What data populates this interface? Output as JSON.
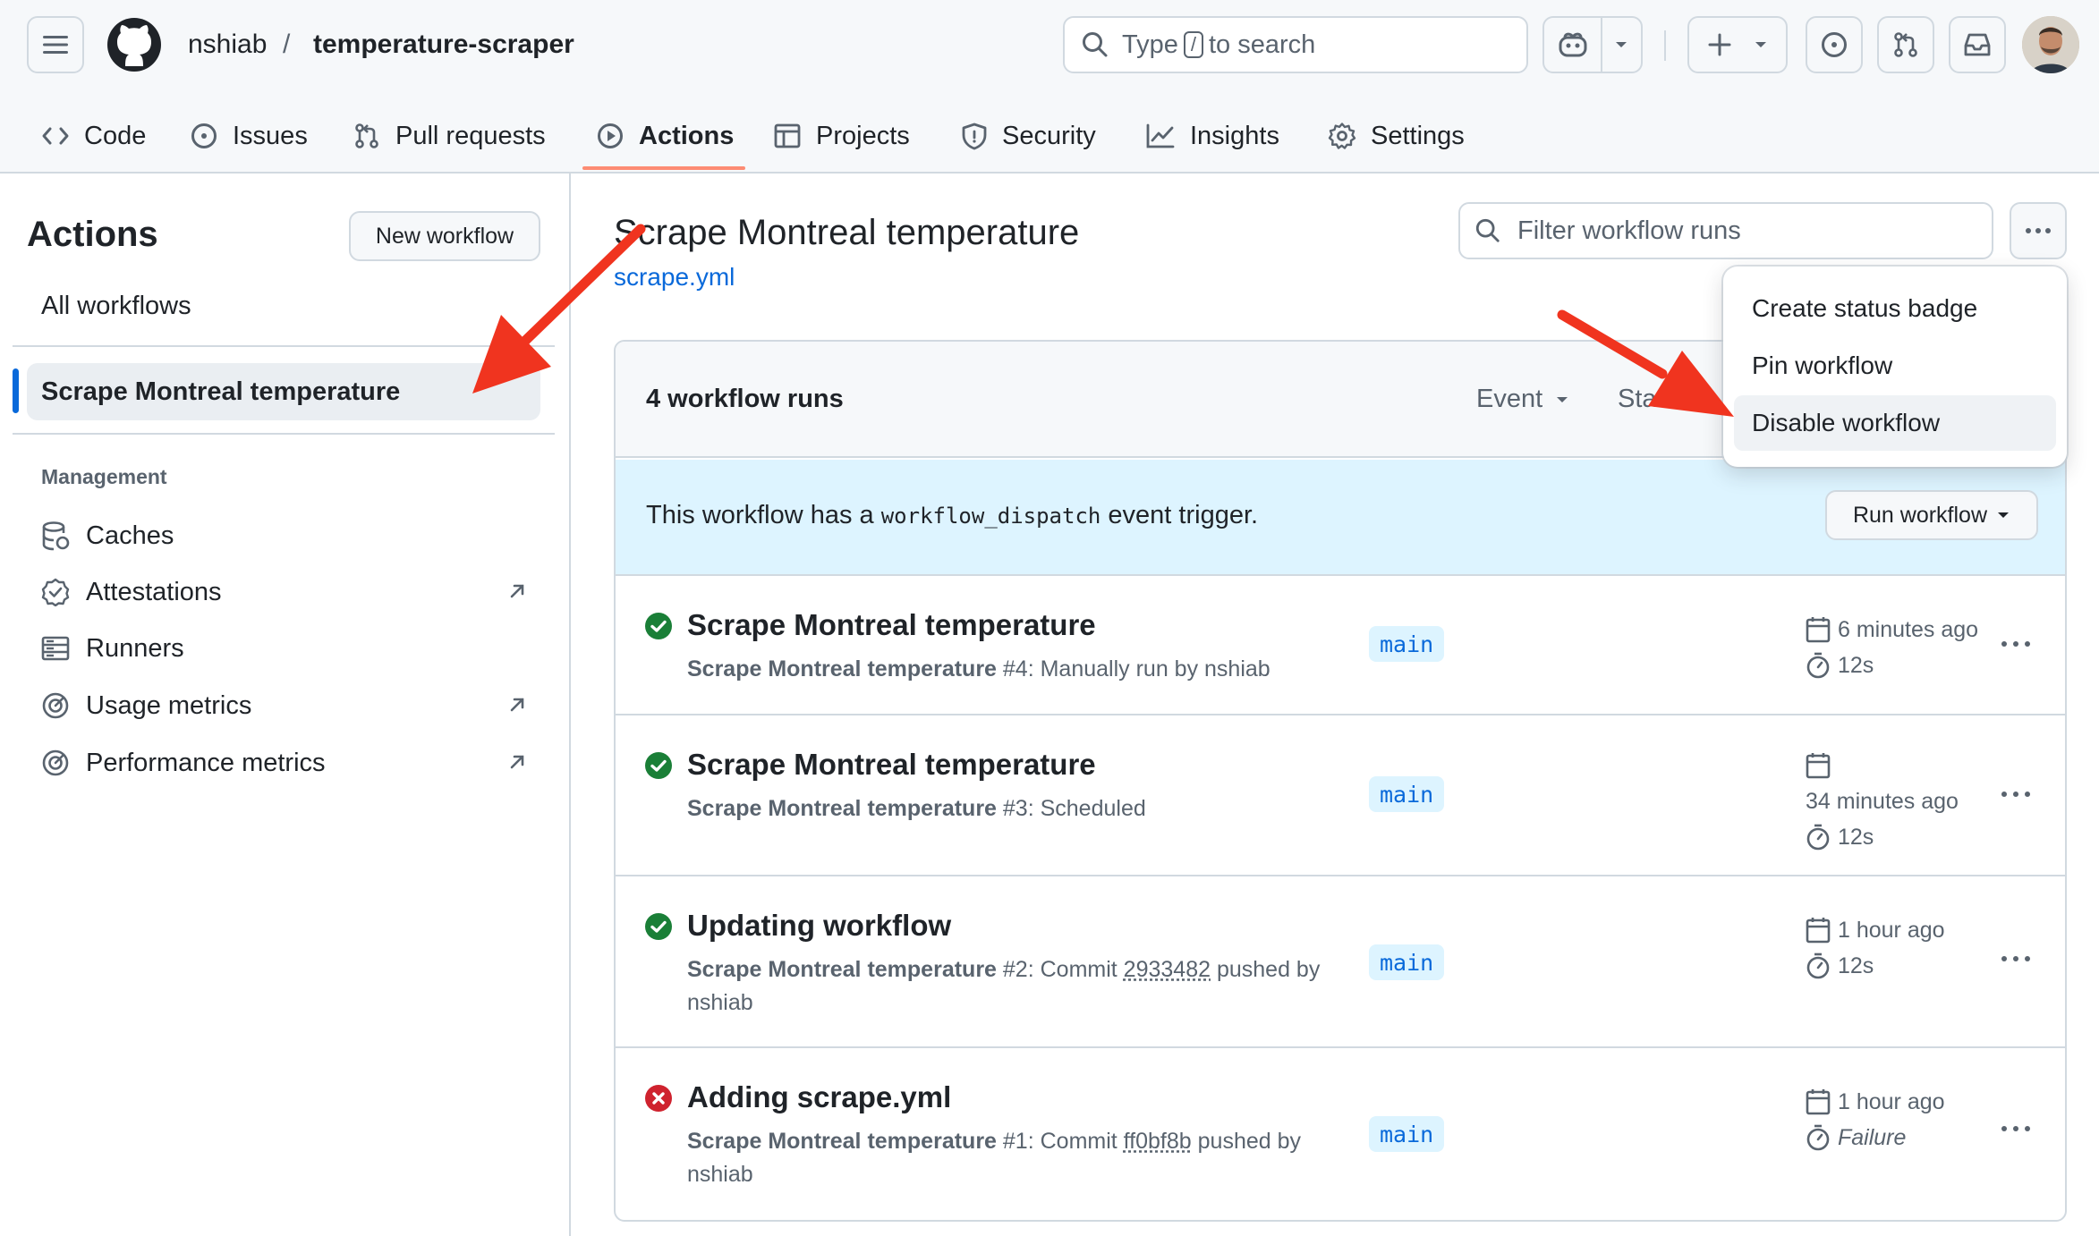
{
  "header": {
    "owner": "nshiab",
    "separator": "/",
    "repo": "temperature-scraper",
    "search": {
      "prefix": "Type",
      "key": "/",
      "suffix": "to search"
    }
  },
  "tabs": [
    {
      "label": "Code",
      "icon": "code-icon"
    },
    {
      "label": "Issues",
      "icon": "issue-icon"
    },
    {
      "label": "Pull requests",
      "icon": "pull-request-icon"
    },
    {
      "label": "Actions",
      "icon": "play-icon",
      "active": true
    },
    {
      "label": "Projects",
      "icon": "table-icon"
    },
    {
      "label": "Security",
      "icon": "shield-icon"
    },
    {
      "label": "Insights",
      "icon": "graph-icon"
    },
    {
      "label": "Settings",
      "icon": "gear-icon"
    }
  ],
  "sidebar": {
    "title": "Actions",
    "new_workflow": "New workflow",
    "all_workflows": "All workflows",
    "selected_workflow": "Scrape Montreal temperature",
    "management_label": "Management",
    "management": [
      {
        "label": "Caches",
        "icon": "database-icon"
      },
      {
        "label": "Attestations",
        "icon": "verified-icon"
      },
      {
        "label": "Runners",
        "icon": "server-icon"
      },
      {
        "label": "Usage metrics",
        "icon": "meter-icon"
      },
      {
        "label": "Performance metrics",
        "icon": "meter-icon"
      }
    ]
  },
  "main": {
    "title": "Scrape Montreal temperature",
    "file": "scrape.yml",
    "filter_placeholder": "Filter workflow runs",
    "runs_count": "4 workflow runs",
    "filters": {
      "event": "Event",
      "status": "Stat"
    },
    "dispatch": {
      "before": "This workflow has a",
      "code": "workflow_dispatch",
      "after": "event trigger."
    },
    "run_workflow": "Run workflow",
    "runs": [
      {
        "status": "success",
        "title": "Scrape Montreal temperature",
        "workflow": "Scrape Montreal temperature",
        "meta_a": "#4: Manually run by nshiab",
        "commit": "",
        "meta_b": "",
        "branch": "main",
        "when": "6 minutes ago",
        "duration": "12s"
      },
      {
        "status": "success",
        "title": "Scrape Montreal temperature",
        "workflow": "Scrape Montreal temperature",
        "meta_a": "#3: Scheduled",
        "commit": "",
        "meta_b": "",
        "branch": "main",
        "when": "34 minutes ago",
        "duration": "12s"
      },
      {
        "status": "success",
        "title": "Updating workflow",
        "workflow": "Scrape Montreal temperature",
        "meta_a": "#2: Commit",
        "commit": "2933482",
        "meta_b": "pushed by nshiab",
        "branch": "main",
        "when": "1 hour ago",
        "duration": "12s"
      },
      {
        "status": "failure",
        "title": "Adding scrape.yml",
        "workflow": "Scrape Montreal temperature",
        "meta_a": "#1: Commit",
        "commit": "ff0bf8b",
        "meta_b": "pushed by nshiab",
        "branch": "main",
        "when": "1 hour ago",
        "duration": "Failure"
      }
    ]
  },
  "menu": {
    "items": [
      "Create status badge",
      "Pin workflow",
      "Disable workflow"
    ]
  },
  "colors": {
    "accent": "#0969da",
    "success": "#1a7f37",
    "danger": "#cf222e",
    "annotation": "#f0341f",
    "tab_underline": "#fd8c73"
  }
}
